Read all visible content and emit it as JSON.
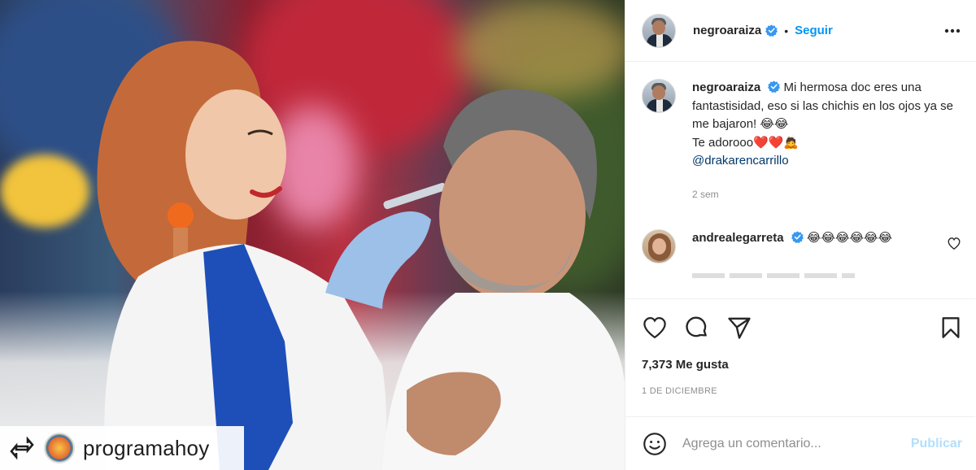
{
  "post": {
    "username": "negroaraiza",
    "follow_label": "Seguir",
    "separator": "•"
  },
  "caption": {
    "username": "negroaraiza",
    "text_line": "Mi hermosa doc eres una fantastisidad, eso si las chichis en los ojos ya se me bajaron! 😂😂",
    "text_line2": "Te adorooo❤️❤️🙇",
    "mention": "@drakarencarrillo",
    "time_ago": "2 sem"
  },
  "comment": {
    "username": "andrealegarreta",
    "text": "😂😂😂😂😂😂"
  },
  "likes_text": "7,373 Me gusta",
  "date_text": "1 DE DICIEMBRE",
  "comment_input": {
    "placeholder": "Agrega un comentario...",
    "post_label": "Publicar"
  },
  "repost": {
    "account": "programahoy"
  },
  "colors": {
    "link": "#0095f6",
    "verified": "#3897f0",
    "post_disabled": "#b2dffc"
  },
  "icons": [
    "repost-icon",
    "verified-icon",
    "more-options-icon",
    "heart-icon",
    "comment-icon",
    "share-icon",
    "bookmark-icon",
    "emoji-icon",
    "small-heart-icon"
  ]
}
